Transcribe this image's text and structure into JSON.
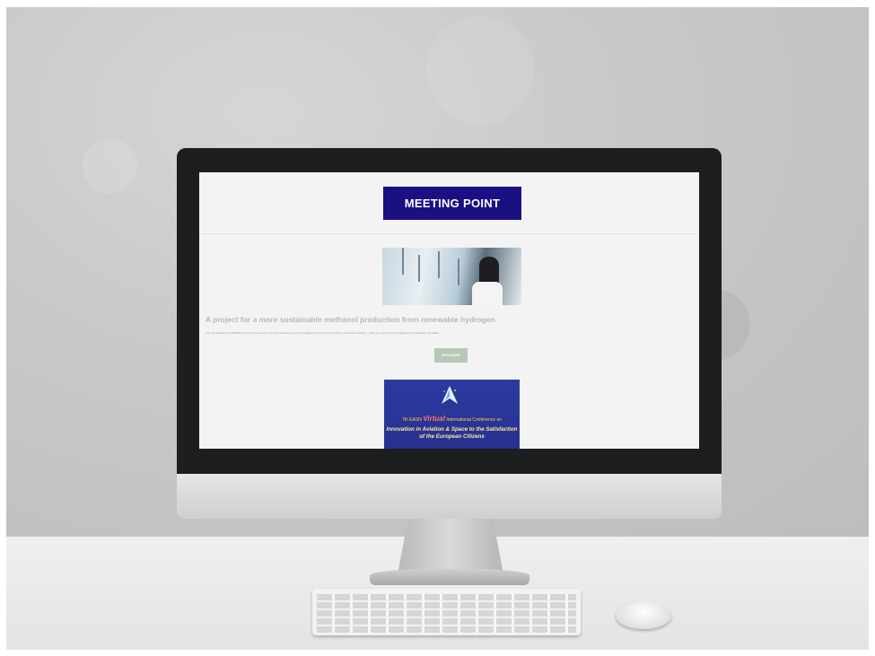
{
  "meeting_point": {
    "label": "MEETING POINT"
  },
  "article": {
    "title": "A project for a more sustainable methanol production from renewable hydrogen",
    "body": "The main objective of the PROMET-H2 project is to develop a concrete technology solution for coupling the process of the production of renewable methanol - reducing its current cost and making it more sustainable and reliable",
    "read_more_label": "READ MORE"
  },
  "conference": {
    "line1_prefix": "7th EASN",
    "line1_virtual": "Virtual",
    "line1_suffix": "International Conference on",
    "line2": "Innovation in Aviation & Space to the Satisfaction",
    "line3": "of the European Citizens"
  },
  "colors": {
    "banner_blue": "#1b1081",
    "button_green": "#b7c8b6",
    "conference_blue": "#2c3aa0"
  }
}
